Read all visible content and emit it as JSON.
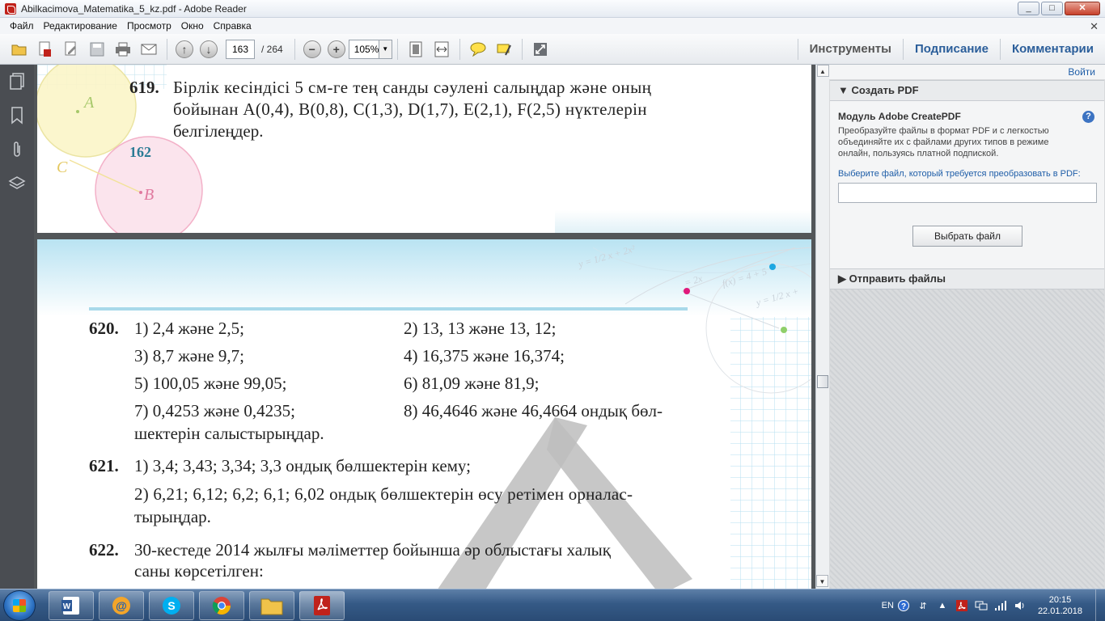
{
  "window": {
    "title": "Abilkacimova_Matematika_5_kz.pdf - Adobe Reader",
    "min": "_",
    "max": "□",
    "close": "✕"
  },
  "menu": [
    "Файл",
    "Редактирование",
    "Просмотр",
    "Окно",
    "Справка"
  ],
  "menu_close": "✕",
  "toolbar": {
    "page_current": "163",
    "page_total": "/ 264",
    "zoom": "105%",
    "tabs": [
      "Инструменты",
      "Подписание",
      "Комментарии"
    ]
  },
  "page1": {
    "page_number": "162",
    "ex619_num": "619.",
    "ex619_lines": [
      "Бірлік кесіндісі 5 см-ге тең санды сәулені салыңдар және оның",
      "бойынан A(0,4), B(0,8), C(1,3), D(1,7), E(2,1), F(2,5) нүктелерін",
      "белгілеңдер."
    ],
    "fig_labels": [
      "A",
      "C",
      "B"
    ]
  },
  "page2": {
    "ex620_num": "620.",
    "ex620_items": [
      "1) 2,4 және 2,5;",
      "2) 13, 13 және 13, 12;",
      "3) 8,7 және 9,7;",
      "4) 16,375 және 16,374;",
      "5) 100,05 және 99,05;",
      "6) 81,09 және 81,9;",
      "7) 0,4253 және 0,4235;",
      "8) 46,4646 және 46,4664 ондық бөл-"
    ],
    "ex620_tail": "шектерін салыстырыңдар.",
    "ex621_num": "621.",
    "ex621_line1": "1) 3,4; 3,43; 3,34; 3,3 ондық бөлшектерін кему;",
    "ex621_line2": "2) 6,21; 6,12; 6,2; 6,1; 6,02 ондық бөлшектерін өсу ретімен орналас-",
    "ex621_line3": "тырыңдар.",
    "ex622_num": "622.",
    "ex622_line1": "30-кестеде 2014 жылғы мәліметтер бойынша әр облыстағы халық",
    "ex622_line2": "саны көрсетілген:",
    "formulas": [
      "y = 1/2 x + 2x²",
      "f(x) = 4 + 5",
      "y = 1/2 x +",
      "= 2x"
    ]
  },
  "rightpane": {
    "login": "Войти",
    "create_pdf": "Создать PDF",
    "module_title": "Модуль Adobe CreatePDF",
    "description": "Преобразуйте файлы в формат PDF и с легкостью объединяйте их с файлами других типов в режиме онлайн, пользуясь платной подпиской.",
    "select_label": "Выберите файл, который требуется преобразовать в PDF:",
    "choose_button": "Выбрать файл",
    "send_files": "Отправить файлы",
    "help": "?"
  },
  "taskbar": {
    "lang": "EN",
    "time": "20:15",
    "date": "22.01.2018"
  },
  "colors": {
    "accent": "#2b5e9a",
    "doc_bg": "#525659",
    "taskbar": "#355a86",
    "pdf_red": "#c0221b"
  }
}
